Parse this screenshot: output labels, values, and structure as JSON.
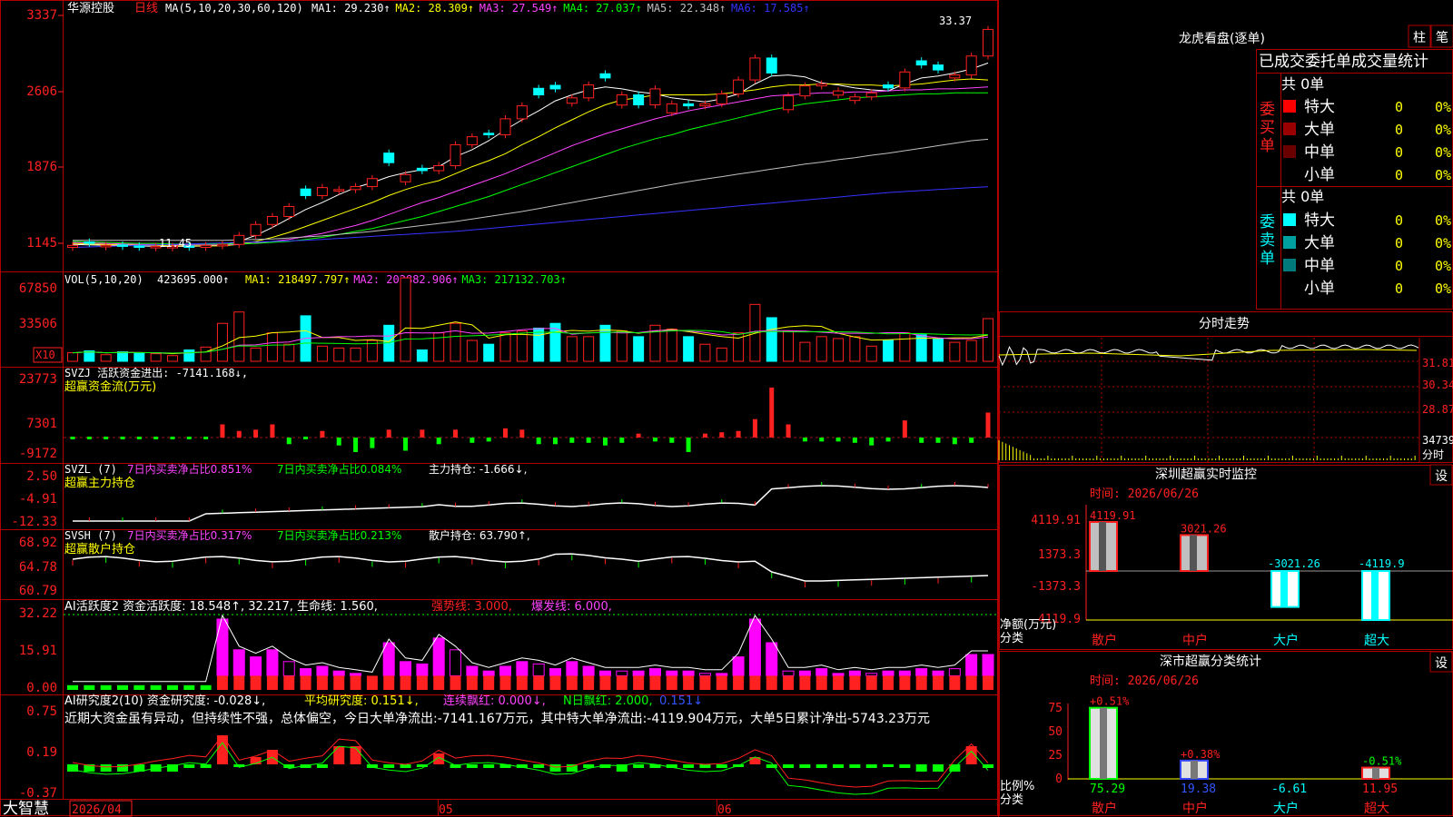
{
  "chart_data": {
    "type": "candlestick",
    "title": "华源控股",
    "period": "日线",
    "ma_header": "MA(5,10,20,30,60,120)",
    "ma_values": [
      {
        "label": "MA1: 29.230↑",
        "color": "#ffffff"
      },
      {
        "label": "MA2: 28.309↑",
        "color": "#ffff00"
      },
      {
        "label": "MA3: 27.549↑",
        "color": "#ff44ff"
      },
      {
        "label": "MA4: 27.037↑",
        "color": "#00ff00"
      },
      {
        "label": "MA5: 22.348↑",
        "color": "#c0c0c0"
      },
      {
        "label": "MA6: 17.585↑",
        "color": "#3333ff"
      }
    ],
    "price_ticks": [
      "3337",
      "2606",
      "1876",
      "1145"
    ],
    "price_range": [
      11.0,
      34.5
    ],
    "high_label": "33.37",
    "low_label": "11.45",
    "date_labels": [
      "2026/04",
      "05",
      "06"
    ],
    "candles_close": [
      11.7,
      11.9,
      11.7,
      11.6,
      11.5,
      11.6,
      11.6,
      11.5,
      11.7,
      11.8,
      12.7,
      13.8,
      14.6,
      15.6,
      16.7,
      17.5,
      17.3,
      17.6,
      18.4,
      20.0,
      18.8,
      19.2,
      19.7,
      21.8,
      22.6,
      22.8,
      24.4,
      25.7,
      26.8,
      27.4,
      26.5,
      27.8,
      28.5,
      26.8,
      25.8,
      27.4,
      25.9,
      25.7,
      25.9,
      26.9,
      28.3,
      30.5,
      29.0,
      26.7,
      27.7,
      27.9,
      27.2,
      26.6,
      27.0,
      27.5,
      29.1,
      29.8,
      29.3,
      28.8,
      30.7,
      33.37
    ],
    "candles_up": [
      1,
      0,
      1,
      0,
      0,
      1,
      1,
      0,
      1,
      1,
      1,
      1,
      1,
      1,
      0,
      1,
      1,
      1,
      1,
      0,
      1,
      0,
      1,
      1,
      1,
      0,
      1,
      1,
      0,
      0,
      1,
      1,
      0,
      1,
      0,
      1,
      1,
      0,
      1,
      1,
      1,
      1,
      0,
      1,
      1,
      1,
      1,
      1,
      1,
      0,
      1,
      0,
      0,
      1,
      1,
      1
    ],
    "ma_series": {
      "MA1": [
        11.8,
        11.75,
        11.7,
        11.7,
        11.65,
        11.6,
        11.6,
        11.6,
        11.65,
        11.7,
        12.1,
        12.7,
        13.5,
        14.4,
        15.3,
        16.0,
        16.8,
        17.5,
        18.0,
        18.6,
        19.0,
        19.3,
        19.6,
        20.6,
        21.3,
        22.2,
        23.3,
        24.3,
        25.2,
        26.2,
        26.8,
        27.3,
        27.6,
        27.4,
        27.1,
        26.9,
        26.5,
        26.3,
        26.1,
        26.4,
        26.9,
        27.9,
        28.7,
        28.8,
        28.6,
        28.0,
        27.8,
        27.5,
        27.3,
        27.2,
        27.9,
        28.5,
        28.7,
        29.0,
        29.4,
        30.0
      ],
      "MA2": [
        11.9,
        11.85,
        11.8,
        11.75,
        11.7,
        11.7,
        11.65,
        11.65,
        11.65,
        11.65,
        11.8,
        12.1,
        12.5,
        13.0,
        13.6,
        14.2,
        14.8,
        15.4,
        16.0,
        16.7,
        17.3,
        17.8,
        18.2,
        18.9,
        19.6,
        20.2,
        20.9,
        21.8,
        22.6,
        23.5,
        24.3,
        25.1,
        25.8,
        26.3,
        26.5,
        26.8,
        26.8,
        26.8,
        26.8,
        26.9,
        27.1,
        27.3,
        27.6,
        27.8,
        27.8,
        27.9,
        27.9,
        27.8,
        27.8,
        27.7,
        27.8,
        27.9,
        28.1,
        28.3,
        28.4,
        28.3
      ],
      "MA3": [
        12.0,
        11.95,
        11.9,
        11.85,
        11.8,
        11.8,
        11.75,
        11.75,
        11.75,
        11.75,
        11.8,
        11.95,
        12.1,
        12.3,
        12.6,
        12.9,
        13.3,
        13.7,
        14.2,
        14.8,
        15.4,
        16.0,
        16.5,
        17.1,
        17.7,
        18.3,
        18.9,
        19.6,
        20.3,
        21.0,
        21.7,
        22.3,
        22.9,
        23.4,
        23.9,
        24.4,
        24.8,
        25.2,
        25.5,
        25.8,
        26.1,
        26.4,
        26.7,
        26.8,
        26.9,
        27.0,
        27.0,
        27.1,
        27.1,
        27.2,
        27.3,
        27.3,
        27.4,
        27.4,
        27.5,
        27.6
      ],
      "MA4": [
        12.1,
        12.05,
        12.0,
        11.95,
        11.9,
        11.9,
        11.85,
        11.85,
        11.85,
        11.85,
        11.85,
        11.9,
        12.0,
        12.1,
        12.3,
        12.5,
        12.8,
        13.1,
        13.4,
        13.8,
        14.2,
        14.6,
        15.1,
        15.6,
        16.1,
        16.6,
        17.2,
        17.8,
        18.4,
        19.0,
        19.6,
        20.2,
        20.8,
        21.4,
        21.9,
        22.4,
        22.8,
        23.3,
        23.7,
        24.1,
        24.5,
        24.9,
        25.3,
        25.6,
        25.9,
        26.1,
        26.3,
        26.5,
        26.6,
        26.7,
        26.8,
        26.9,
        26.9,
        27.0,
        27.0,
        27.0
      ],
      "MA5": [
        12.2,
        12.2,
        12.2,
        12.2,
        12.2,
        12.2,
        12.2,
        12.2,
        12.2,
        12.2,
        12.25,
        12.3,
        12.35,
        12.45,
        12.55,
        12.65,
        12.8,
        12.95,
        13.1,
        13.3,
        13.5,
        13.7,
        13.9,
        14.1,
        14.35,
        14.6,
        14.85,
        15.1,
        15.4,
        15.7,
        16.0,
        16.3,
        16.6,
        16.9,
        17.2,
        17.5,
        17.8,
        18.1,
        18.35,
        18.6,
        18.85,
        19.1,
        19.35,
        19.6,
        19.85,
        20.05,
        20.3,
        20.5,
        20.75,
        20.95,
        21.2,
        21.45,
        21.7,
        21.95,
        22.2,
        22.35
      ],
      "MA6": [
        11.5,
        11.55,
        11.6,
        11.65,
        11.7,
        11.75,
        11.8,
        11.85,
        11.9,
        11.95,
        12.0,
        12.05,
        12.1,
        12.15,
        12.2,
        12.3,
        12.4,
        12.5,
        12.6,
        12.7,
        12.8,
        12.9,
        13.0,
        13.1,
        13.25,
        13.4,
        13.55,
        13.7,
        13.85,
        14.0,
        14.15,
        14.3,
        14.45,
        14.6,
        14.75,
        14.9,
        15.05,
        15.2,
        15.35,
        15.5,
        15.65,
        15.8,
        15.95,
        16.1,
        16.25,
        16.4,
        16.55,
        16.7,
        16.85,
        17.0,
        17.1,
        17.2,
        17.3,
        17.4,
        17.5,
        17.585
      ]
    },
    "volume": {
      "header": "VOL(5,10,20)",
      "current": "423695.000↑",
      "labels": [
        "MA1: 218497.797↑",
        "MA2: 202882.906↑",
        "MA3: 217132.703↑"
      ],
      "ticks": [
        "67850",
        "33506"
      ],
      "unit": "X10",
      "values": [
        9,
        11,
        7,
        10,
        9,
        8,
        6,
        12,
        15,
        40,
        52,
        14,
        30,
        18,
        48,
        16,
        14,
        14,
        22,
        38,
        88,
        12,
        30,
        40,
        22,
        18,
        30,
        32,
        35,
        40,
        26,
        26,
        38,
        32,
        26,
        38,
        34,
        26,
        18,
        14,
        30,
        60,
        46,
        32,
        20,
        26,
        24,
        26,
        16,
        22,
        30,
        28,
        24,
        20,
        22,
        45
      ]
    },
    "svzj": {
      "header": "SVZJ  活跃资金进出: -7141.168↓,",
      "subtitle": "超赢资金流(万元)",
      "ticks": [
        "23773",
        "7301",
        "-9172"
      ],
      "values": [
        0,
        0,
        0,
        0,
        0,
        0,
        0,
        0,
        0,
        10,
        5,
        6,
        10,
        -5,
        0,
        5,
        -6,
        -11,
        -8,
        6,
        -10,
        6,
        -5,
        6,
        -4,
        -3,
        7,
        6,
        -5,
        -5,
        -4,
        -4,
        -6,
        -4,
        3,
        -3,
        -4,
        -11,
        3,
        4,
        5,
        14,
        38,
        10,
        -3,
        -3,
        -3,
        -4,
        -6,
        -3,
        13,
        -4,
        -4,
        -5,
        -4,
        19,
        -12
      ],
      "visible": true
    },
    "svzl": {
      "header": "SVZL (7)",
      "l1": "7日内买卖净占比0.851%",
      "l2": "7日内买卖净占比0.084%",
      "l3": "主力持仓: -1.666↓,",
      "subtitle": "超赢主力持仓",
      "ticks": [
        "2.50",
        "-4.91",
        "-12.33"
      ]
    },
    "svsh": {
      "header": "SVSH (7)",
      "l1": "7日内买卖净占比0.317%",
      "l2": "7日内买卖净占比0.213%",
      "l3": "散户持仓: 63.790↑,",
      "subtitle": "超赢散户持仓",
      "ticks": [
        "68.92",
        "64.78",
        "60.79"
      ]
    },
    "ai_active": {
      "header": "AI活跃度2 资金活跃度: 18.548↑, 32.217, 生命线: 1.560,",
      "strong": "强势线: 3.000,",
      "burst": "爆发线: 6.000,",
      "ticks": [
        "32.22",
        "15.91",
        "0.00"
      ]
    },
    "ai_research": {
      "header": "AI研究度2(10) 资金研究度: -0.028↓,",
      "avg": "平均研究度: 0.151↓,",
      "lianxu": "连续飘红: 0.000↓,",
      "nday": "N日飘红: 2.000,",
      "last": "0.151↓",
      "summary": "近期大资金虽有异动，但持续性不强，总体偏空，今日大单净流出:-7141.167万元，其中特大单净流出:-4119.904万元，大单5日累计净出-5743.23万元",
      "ticks": [
        "0.75",
        "0.19",
        "-0.37"
      ]
    }
  },
  "watermark": "大智慧",
  "right": {
    "top_buttons": [
      "柱",
      "笔"
    ],
    "lhb_title": "龙虎看盘(逐单)",
    "stat_header": "已成交委托单成交量统计",
    "buy_label": "委买单",
    "sell_label": "委卖单",
    "buy_total": "共 0单",
    "sell_total": "共 0单",
    "buy_rows": [
      {
        "name": "特大",
        "count": "0",
        "pct": "0%",
        "color": "#ff0000"
      },
      {
        "name": "大单",
        "count": "0",
        "pct": "0%",
        "color": "#9a0000"
      },
      {
        "name": "中单",
        "count": "0",
        "pct": "0%",
        "color": "#6a0000"
      },
      {
        "name": "小单",
        "count": "0",
        "pct": "0%",
        "color": "#000000"
      }
    ],
    "sell_rows": [
      {
        "name": "特大",
        "count": "0",
        "pct": "0%",
        "color": "#00ffff"
      },
      {
        "name": "大单",
        "count": "0",
        "pct": "0%",
        "color": "#00a0a0"
      },
      {
        "name": "中单",
        "count": "0",
        "pct": "0%",
        "color": "#007a7a"
      },
      {
        "name": "小单",
        "count": "0",
        "pct": "0%",
        "color": "#000000"
      }
    ],
    "intraday_title": "分时走势",
    "intraday_ticks": [
      "31.81",
      "30.34",
      "28.87",
      "34739"
    ],
    "intraday_unit": "分时",
    "monitor": {
      "title": "深圳超赢实时监控",
      "set_button": "设",
      "time": "时间: 2026/06/26",
      "ticks": [
        "4119.91",
        "1373.3",
        "-1373.3",
        "-4119.9"
      ],
      "unit": "净额(万元)",
      "cat_label": "分类",
      "categories": [
        "散户",
        "中户",
        "大户",
        "超大"
      ],
      "values": [
        4119.91,
        3021.26,
        -3021.26,
        -4119.9
      ],
      "value_labels": [
        "4119.91",
        "3021.26",
        "-3021.26",
        "-4119.9"
      ]
    },
    "classify": {
      "title": "深市超赢分类统计",
      "set_button": "设",
      "time": "时间: 2026/06/26",
      "ticks": [
        "75",
        "50",
        "25",
        "0"
      ],
      "unit": "比例%",
      "cat_label": "分类",
      "categories": [
        "散户",
        "中户",
        "大户",
        "超大"
      ],
      "bar_values": [
        75.29,
        19.38,
        -6.61,
        11.95
      ],
      "bar_labels": [
        "+0.51%",
        "+0.38%",
        "",
        "-0.51%"
      ],
      "value_labels": [
        "75.29",
        "19.38",
        "-6.61",
        "11.95"
      ]
    }
  }
}
